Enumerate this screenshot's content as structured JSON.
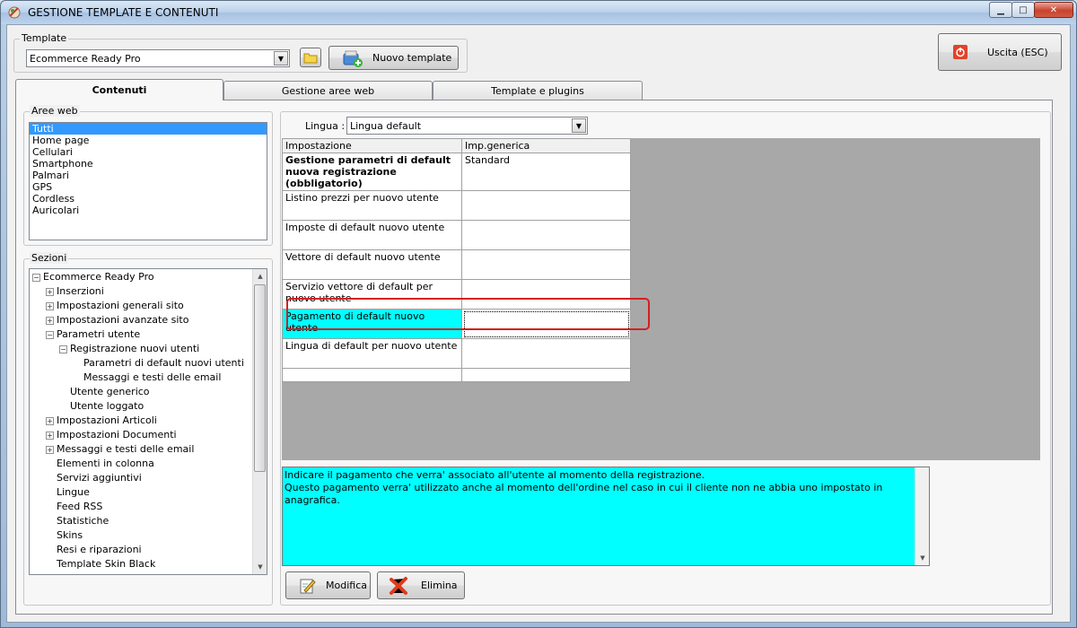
{
  "window": {
    "title": "GESTIONE TEMPLATE E CONTENUTI"
  },
  "template_group": {
    "legend": "Template",
    "selected": "Ecommerce Ready Pro",
    "new_button": "Nuovo template"
  },
  "exit_button": "Uscita (ESC)",
  "tabs": [
    {
      "label": "Contenuti",
      "active": true
    },
    {
      "label": "Gestione aree web",
      "active": false
    },
    {
      "label": "Template e plugins",
      "active": false
    }
  ],
  "aree_web": {
    "legend": "Aree web",
    "items": [
      "Tutti",
      "Home page",
      "Cellulari",
      "Smartphone",
      "Palmari",
      "GPS",
      "Cordless",
      "Auricolari"
    ],
    "selected_index": 0
  },
  "sezioni": {
    "legend": "Sezioni",
    "tree": [
      {
        "label": "Ecommerce Ready Pro",
        "level": 0,
        "exp": "−"
      },
      {
        "label": "Inserzioni",
        "level": 1,
        "exp": "+"
      },
      {
        "label": "Impostazioni generali sito",
        "level": 1,
        "exp": "+"
      },
      {
        "label": "Impostazioni avanzate sito",
        "level": 1,
        "exp": "+"
      },
      {
        "label": "Parametri utente",
        "level": 1,
        "exp": "−"
      },
      {
        "label": "Registrazione nuovi utenti",
        "level": 2,
        "exp": "−"
      },
      {
        "label": "Parametri di default nuovi utenti",
        "level": 3,
        "exp": ""
      },
      {
        "label": "Messaggi e testi delle email",
        "level": 3,
        "exp": ""
      },
      {
        "label": "Utente generico",
        "level": 2,
        "exp": ""
      },
      {
        "label": "Utente loggato",
        "level": 2,
        "exp": ""
      },
      {
        "label": "Impostazioni Articoli",
        "level": 1,
        "exp": "+"
      },
      {
        "label": "Impostazioni Documenti",
        "level": 1,
        "exp": "+"
      },
      {
        "label": "Messaggi e testi delle email",
        "level": 1,
        "exp": "+"
      },
      {
        "label": "Elementi in colonna",
        "level": 1,
        "exp": ""
      },
      {
        "label": "Servizi aggiuntivi",
        "level": 1,
        "exp": ""
      },
      {
        "label": "Lingue",
        "level": 1,
        "exp": ""
      },
      {
        "label": "Feed RSS",
        "level": 1,
        "exp": ""
      },
      {
        "label": "Statistiche",
        "level": 1,
        "exp": ""
      },
      {
        "label": "Skins",
        "level": 1,
        "exp": ""
      },
      {
        "label": "Resi e riparazioni",
        "level": 1,
        "exp": ""
      },
      {
        "label": "Template Skin Black",
        "level": 1,
        "exp": ""
      }
    ]
  },
  "lingua": {
    "label": "Lingua :",
    "selected": "Lingua default"
  },
  "grid": {
    "headers": [
      "Impostazione",
      "Imp.generica"
    ],
    "rows": [
      {
        "name": "Gestione parametri di default nuova registrazione (obbligatorio)",
        "value": "Standard",
        "bold": true,
        "highlight": false
      },
      {
        "name": "Listino prezzi per nuovo utente",
        "value": "",
        "bold": false,
        "highlight": false
      },
      {
        "name": "Imposte di default nuovo utente",
        "value": "",
        "bold": false,
        "highlight": false
      },
      {
        "name": "Vettore di default nuovo utente",
        "value": "",
        "bold": false,
        "highlight": false
      },
      {
        "name": "Servizio vettore di default per nuovo utente",
        "value": "",
        "bold": false,
        "highlight": false
      },
      {
        "name": "Pagamento di default nuovo utente",
        "value": "",
        "bold": false,
        "highlight": true
      },
      {
        "name": "Lingua di default per nuovo utente",
        "value": "",
        "bold": false,
        "highlight": false
      }
    ]
  },
  "info_text": {
    "line1": "Indicare il pagamento che verra' associato all'utente al momento della registrazione.",
    "line2": "Questo pagamento verra' utilizzato anche al momento dell'ordine nel caso in cui il cliente non ne abbia uno impostato in anagrafica."
  },
  "actions": {
    "modifica": "Modifica",
    "elimina": "Elimina"
  },
  "colors": {
    "highlight": "#00ffff",
    "selection": "#3399ff",
    "annotation": "#d42020"
  }
}
